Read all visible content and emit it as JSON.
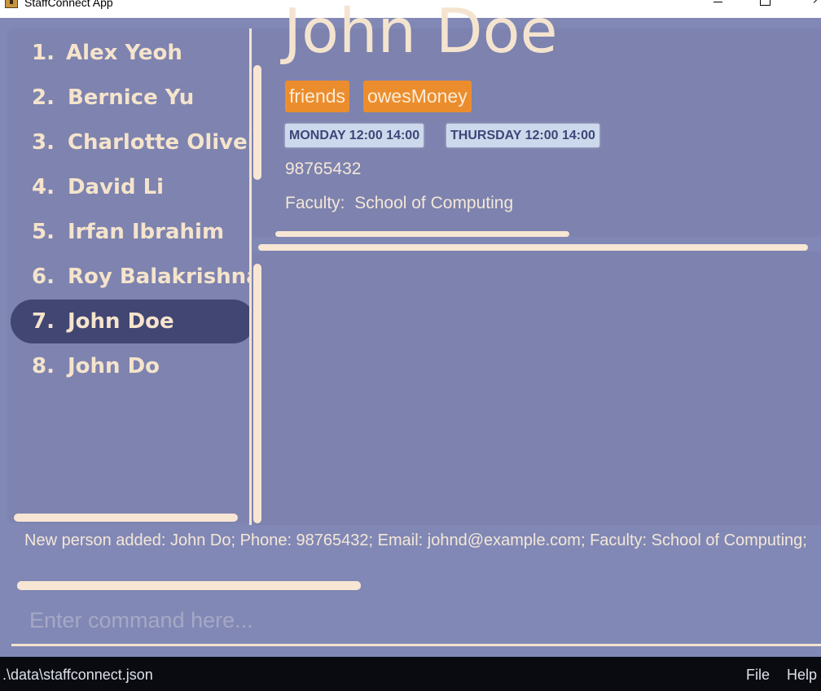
{
  "window": {
    "title": "StaffConnect App"
  },
  "person_list": {
    "items": [
      {
        "index": "1.",
        "name": "Alex Yeoh"
      },
      {
        "index": "2.",
        "name": "Bernice Yu"
      },
      {
        "index": "3.",
        "name": "Charlotte Oliveiro"
      },
      {
        "index": "4.",
        "name": "David Li"
      },
      {
        "index": "5.",
        "name": "Irfan Ibrahim"
      },
      {
        "index": "6.",
        "name": "Roy Balakrishnan"
      },
      {
        "index": "7.",
        "name": "John Doe"
      },
      {
        "index": "8.",
        "name": "John Do"
      }
    ],
    "selected_index": 7
  },
  "details": {
    "name": "John Doe",
    "tags": [
      "friends",
      "owesMoney"
    ],
    "availability": [
      "MONDAY 12:00 14:00",
      "THURSDAY 12:00 14:00"
    ],
    "phone": "98765432",
    "faculty_label": "Faculty:",
    "faculty": "School of Computing"
  },
  "result": {
    "message": "New person added: John Do; Phone: 98765432; Email: johnd@example.com; Faculty: School of Computing;"
  },
  "command": {
    "placeholder": "Enter command here...",
    "value": ""
  },
  "status_bar": {
    "path": ".\\data\\staffconnect.json"
  },
  "menu": {
    "file": "File",
    "help": "Help"
  },
  "colors": {
    "background": "#8188b5",
    "list_selected": "#414673",
    "tag": "#ec8d2d",
    "availability": "#ccd9ec",
    "text": "#f4e4cf",
    "status_bar": "#0a0b11"
  }
}
